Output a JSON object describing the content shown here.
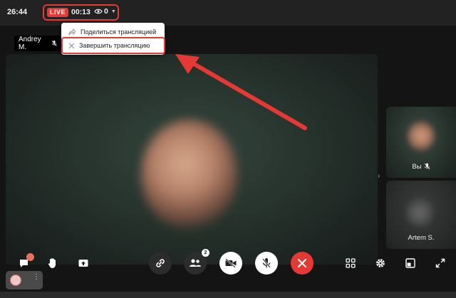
{
  "topbar": {
    "time": "26:44",
    "live_badge": "LIVE",
    "live_timer": "00:13",
    "viewer_count": "0",
    "live_color": "#e53935"
  },
  "menu": {
    "items": [
      {
        "label": "Поделиться трансляцией",
        "icon": "share-icon"
      },
      {
        "label": "Завершить трансляцию",
        "icon": "close-icon",
        "highlighted": true
      }
    ]
  },
  "main_video": {
    "participant_name": "Andrey M."
  },
  "sidebar": {
    "tiles": [
      {
        "label": "Вы",
        "muted": true
      },
      {
        "label": "Artem S.",
        "muted": false
      }
    ]
  },
  "toolbar": {
    "participants_badge": "2",
    "end_call_color": "#e53935",
    "icons": [
      "chat-icon",
      "raise-hand-icon",
      "share-screen-icon",
      "link-icon",
      "participants-icon",
      "camera-off-icon",
      "mic-off-icon",
      "end-call-icon",
      "grid-icon",
      "settings-icon",
      "pip-icon",
      "fullscreen-icon"
    ]
  }
}
